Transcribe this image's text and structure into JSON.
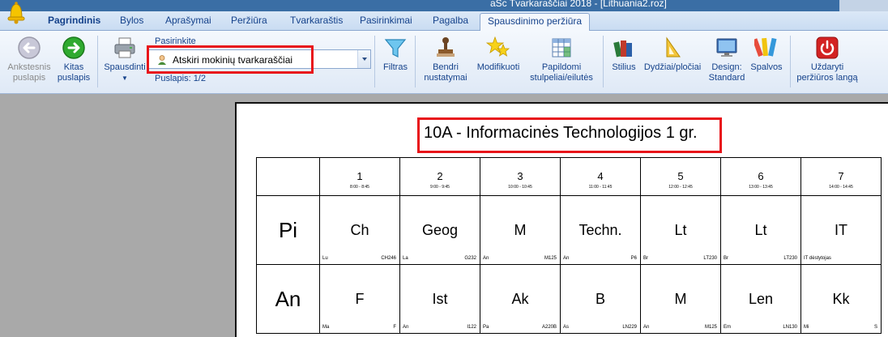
{
  "window": {
    "title": "aSc Tvarkaraščiai 2018 - [Lithuania2.roz]"
  },
  "tabs": [
    "Pagrindinis",
    "Bylos",
    "Aprašymai",
    "Peržiūra",
    "Tvarkaraštis",
    "Pasirinkimai",
    "Pagalba",
    "Spausdinimo peržiūra"
  ],
  "ribbon": {
    "prev": {
      "line1": "Ankstesnis",
      "line2": "puslapis"
    },
    "next": {
      "line1": "Kitas",
      "line2": "puslapis"
    },
    "print": "Spausdinti",
    "select_label": "Pasirinkite",
    "select_value": "Atskiri mokinių tvarkaraščiai",
    "page_info": "Puslapis: 1/2",
    "filter": "Filtras",
    "common_settings": {
      "line1": "Bendri",
      "line2": "nustatymai"
    },
    "modify": "Modifikuoti",
    "extra_cols": {
      "line1": "Papildomi",
      "line2": "stulpeliai/eilutės"
    },
    "style": "Stilius",
    "sizes": "Dydžiai/pločiai",
    "design": {
      "line1": "Design:",
      "line2": "Standard"
    },
    "colors": "Spalvos",
    "close_preview": {
      "line1": "Uždaryti",
      "line2": "peržiūros langą"
    }
  },
  "timetable": {
    "title": "10A - Informacinės Technologijos 1 gr.",
    "periods": [
      {
        "num": "1",
        "time": "8:00 - 8:45"
      },
      {
        "num": "2",
        "time": "9:00 - 9:45"
      },
      {
        "num": "3",
        "time": "10:00 - 10:45"
      },
      {
        "num": "4",
        "time": "11:00 - 11:45"
      },
      {
        "num": "5",
        "time": "12:00 - 12:45"
      },
      {
        "num": "6",
        "time": "13:00 - 13:45"
      },
      {
        "num": "7",
        "time": "14:00 - 14:45"
      }
    ],
    "days": [
      {
        "name": "Pi",
        "cells": [
          {
            "subject": "Ch",
            "teacher": "Lu",
            "room": "CH246"
          },
          {
            "subject": "Geog",
            "teacher": "La",
            "room": "G232"
          },
          {
            "subject": "M",
            "teacher": "An",
            "room": "M125"
          },
          {
            "subject": "Techn.",
            "teacher": "An",
            "room": "P6"
          },
          {
            "subject": "Lt",
            "teacher": "Br",
            "room": "LT230"
          },
          {
            "subject": "Lt",
            "teacher": "Br",
            "room": "LT230"
          },
          {
            "subject": "IT",
            "teacher": "IT dėstytojas",
            "room": ""
          }
        ]
      },
      {
        "name": "An",
        "cells": [
          {
            "subject": "F",
            "teacher": "Ma",
            "room": "F"
          },
          {
            "subject": "Ist",
            "teacher": "An",
            "room": "I122"
          },
          {
            "subject": "Ak",
            "teacher": "Pa",
            "room": "A220B"
          },
          {
            "subject": "B",
            "teacher": "As",
            "room": "LN229"
          },
          {
            "subject": "M",
            "teacher": "An",
            "room": "M125"
          },
          {
            "subject": "Len",
            "teacher": "Em",
            "room": "LN130"
          },
          {
            "subject": "Kk",
            "teacher": "Mi",
            "room": "S"
          }
        ]
      }
    ]
  }
}
